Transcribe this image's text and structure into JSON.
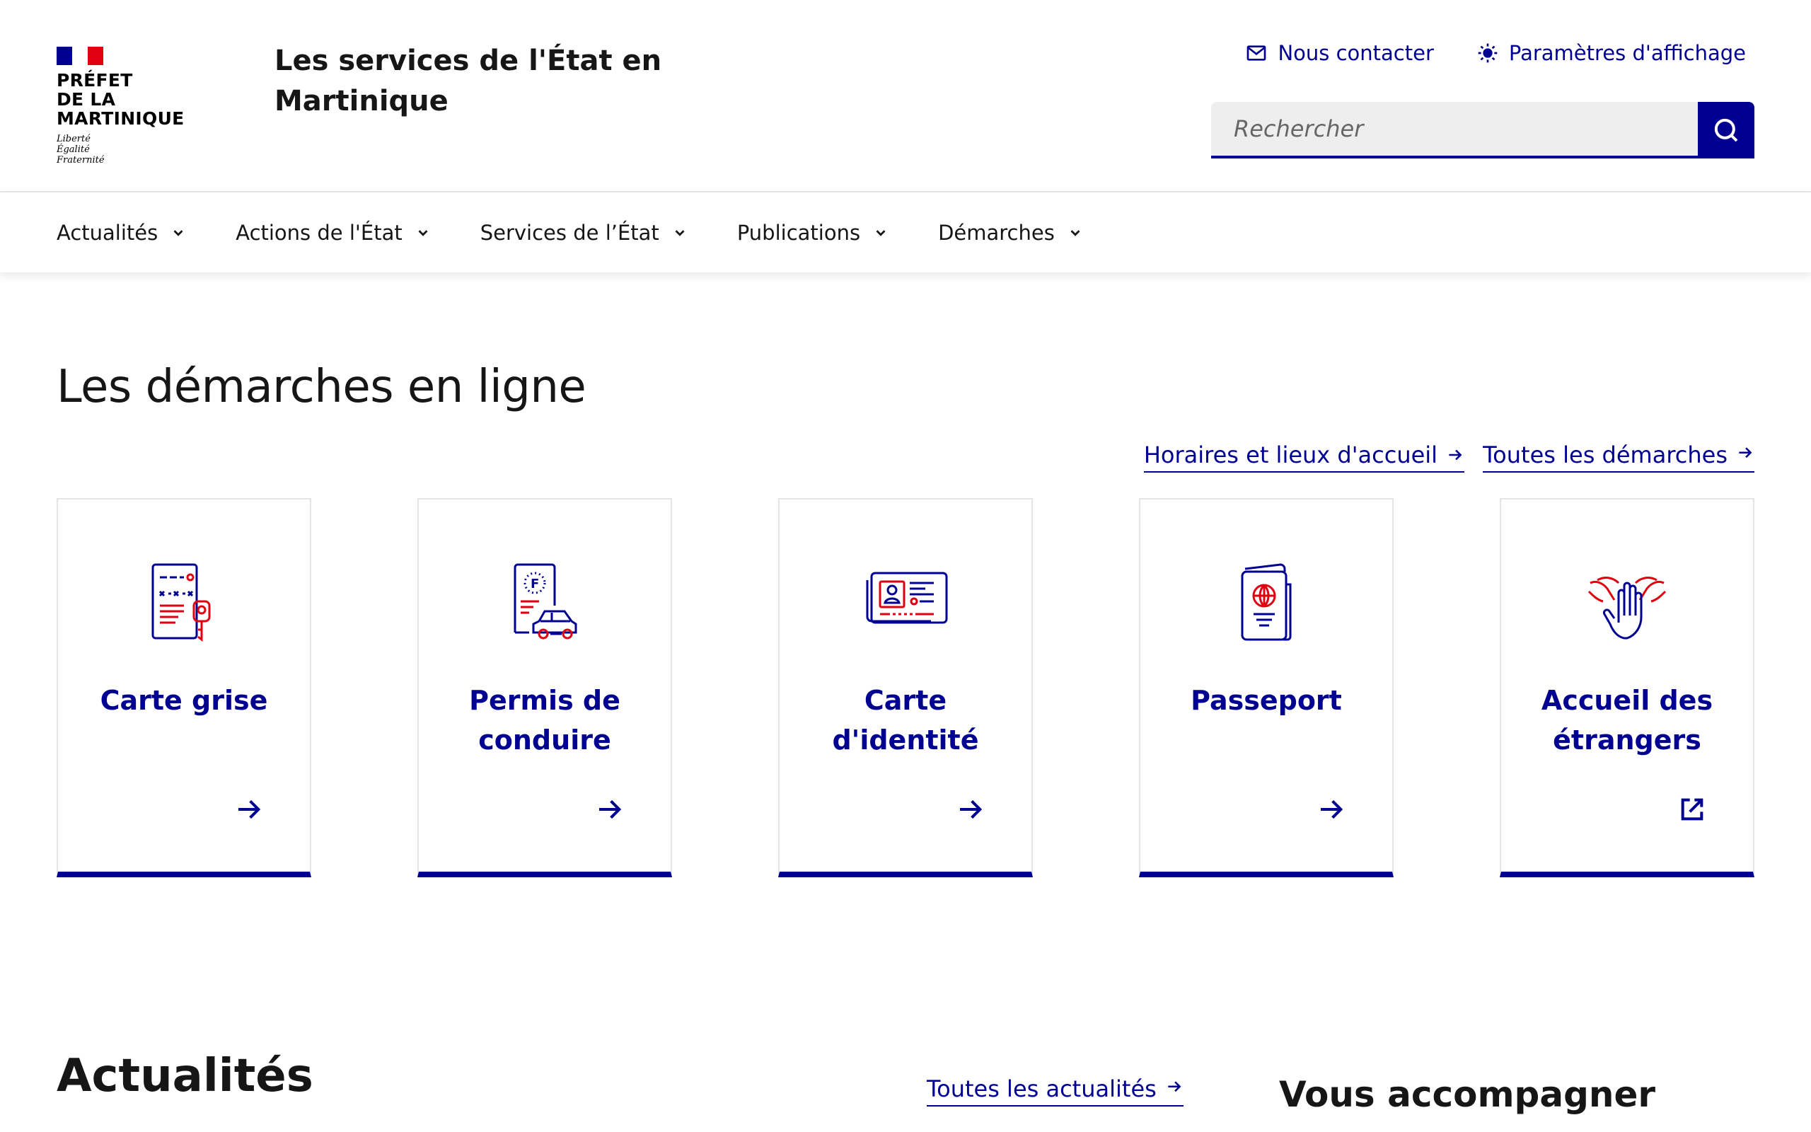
{
  "header": {
    "logo": {
      "line1": "PRÉFET",
      "line2": "DE LA MARTINIQUE",
      "motto1": "Liberté",
      "motto2": "Égalité",
      "motto3": "Fraternité"
    },
    "site_title": "Les services de l'État en Martinique",
    "contact_label": "Nous contacter",
    "settings_label": "Paramètres d'affichage",
    "search_placeholder": "Rechercher"
  },
  "nav": {
    "items": [
      {
        "label": "Actualités"
      },
      {
        "label": "Actions de l'État"
      },
      {
        "label": "Services de l’État"
      },
      {
        "label": "Publications"
      },
      {
        "label": "Démarches"
      }
    ]
  },
  "demarches": {
    "title": "Les démarches en ligne",
    "link_horaires": "Horaires et lieux d'accueil",
    "link_toutes": "Toutes les démarches",
    "cards": [
      {
        "title": "Carte grise",
        "icon": "vehicle-registration-icon",
        "link_icon": "arrow-right-icon"
      },
      {
        "title": "Permis de conduire",
        "icon": "driving-license-icon",
        "link_icon": "arrow-right-icon"
      },
      {
        "title": "Carte d'identité",
        "icon": "id-card-icon",
        "link_icon": "arrow-right-icon"
      },
      {
        "title": "Passeport",
        "icon": "passport-icon",
        "link_icon": "arrow-right-icon"
      },
      {
        "title": "Accueil des étrangers",
        "icon": "welcome-hands-icon",
        "link_icon": "external-link-icon"
      }
    ]
  },
  "actualites": {
    "title": "Actualités",
    "link_all": "Toutes les actualités",
    "side_title": "Vous accompagner"
  },
  "colors": {
    "primary": "#000091",
    "accent": "#e1000f",
    "text": "#161616"
  }
}
